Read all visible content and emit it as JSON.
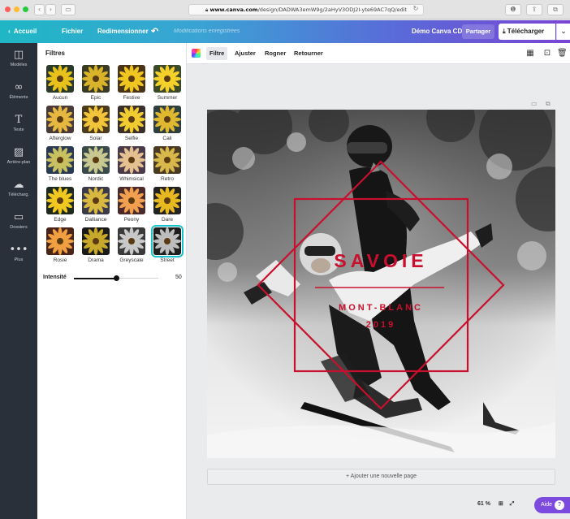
{
  "browser": {
    "url_domain": "www.canva.com",
    "url_path": "/design/DADWA3emW9g/2aHyV3ODJ2I-yte69AC7qQ/edit",
    "lock_icon": "lock-icon"
  },
  "topbar": {
    "back_label": "Accueil",
    "file_label": "Fichier",
    "resize_label": "Redimensionner",
    "saved_status": "Modifications enregistrées",
    "account_label": "Démo Canva CD",
    "share_label": "Partager",
    "download_label": "Télécharger"
  },
  "rail": {
    "items": [
      {
        "label": "Modèles",
        "icon": "templates-icon"
      },
      {
        "label": "Éléments",
        "icon": "elements-icon"
      },
      {
        "label": "Texte",
        "icon": "text-icon"
      },
      {
        "label": "Arrière-plan",
        "icon": "background-icon"
      },
      {
        "label": "Télécharg.",
        "icon": "upload-icon"
      },
      {
        "label": "Dossiers",
        "icon": "folder-icon"
      },
      {
        "label": "Plus",
        "icon": "more-icon"
      }
    ]
  },
  "filters": {
    "title": "Filtres",
    "items": [
      {
        "name": "Aucun"
      },
      {
        "name": "Epic"
      },
      {
        "name": "Festive"
      },
      {
        "name": "Summer"
      },
      {
        "name": "Afterglow"
      },
      {
        "name": "Solar"
      },
      {
        "name": "Selfie"
      },
      {
        "name": "Cali"
      },
      {
        "name": "The blues"
      },
      {
        "name": "Nordic"
      },
      {
        "name": "Whimsical"
      },
      {
        "name": "Retro"
      },
      {
        "name": "Edge"
      },
      {
        "name": "Dalliance"
      },
      {
        "name": "Peony"
      },
      {
        "name": "Dare"
      },
      {
        "name": "Rosie"
      },
      {
        "name": "Drama"
      },
      {
        "name": "Greyscale"
      },
      {
        "name": "Street"
      }
    ],
    "selected": "Street",
    "intensity_label": "Intensité",
    "intensity_value": "50",
    "intensity_fraction": 0.5
  },
  "toolbar": {
    "filter_label": "Filtre",
    "adjust_label": "Ajuster",
    "crop_label": "Rogner",
    "flip_label": "Retourner"
  },
  "design": {
    "line1": "SAVOIE",
    "line2": "MONT-BLANC",
    "line3": "2019",
    "accent_color": "#c8102e"
  },
  "canvas": {
    "add_page_label": "+ Ajouter une nouvelle page",
    "zoom_label": "61 %"
  },
  "help": {
    "label": "Aide",
    "symbol": "?"
  }
}
